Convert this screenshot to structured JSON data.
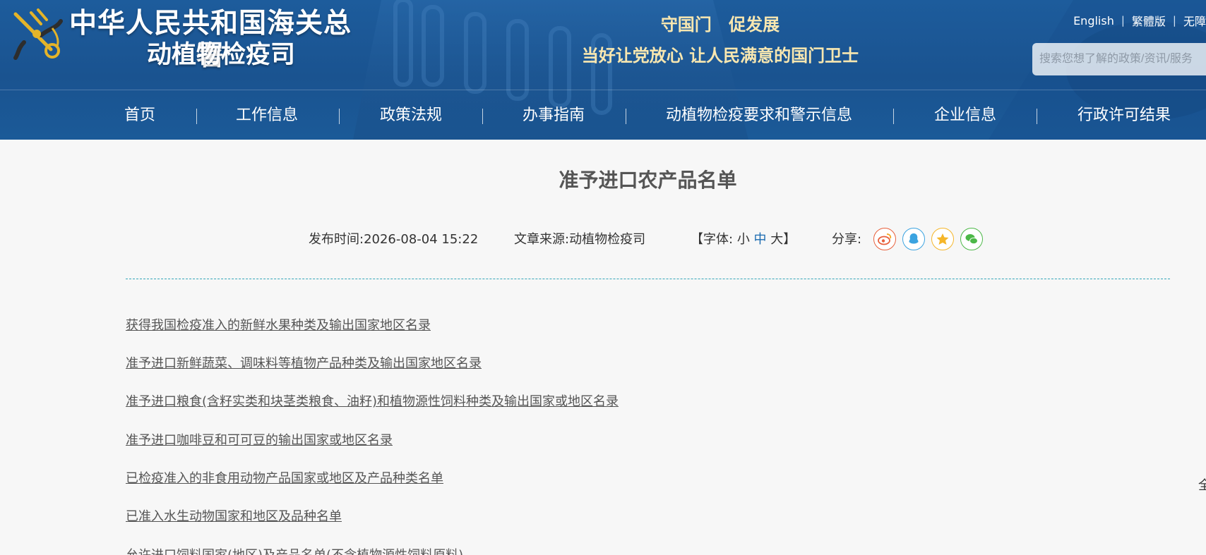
{
  "header": {
    "title_line1": "中华人民共和国海关总署",
    "title_line2": "动植物检疫司",
    "slogan_line1": "守国门  促发展",
    "slogan_line2": "当好让党放心   让人民满意的国门卫士",
    "lang_links": [
      "English",
      "繁體版",
      "无障"
    ],
    "search_placeholder": "搜索您想了解的政策/资讯/服务"
  },
  "nav": {
    "items": [
      "首页",
      "工作信息",
      "政策法规",
      "办事指南",
      "动植物检疫要求和警示信息",
      "企业信息",
      "行政许可结果"
    ]
  },
  "article": {
    "title": "准予进口农产品名单",
    "publish_label": "发布时间:",
    "publish_time": "2026-08-04 15:22",
    "source_label": "文章来源:",
    "source": "动植物检疫司",
    "font_prefix": "【字体:",
    "font_small": "小",
    "font_medium": "中",
    "font_large": "大",
    "font_suffix": "】",
    "share_label": "分享:",
    "share_icons": [
      "weibo-icon",
      "qq-icon",
      "qzone-icon",
      "wechat-icon"
    ],
    "links": [
      "获得我国检疫准入的新鲜水果种类及输出国家地区名录",
      "准予进口新鲜蔬菜、调味料等植物产品种类及输出国家地区名录",
      "准予进口粮食(含籽实类和块茎类粮食、油籽)和植物源性饲料种类及输出国家或地区名录",
      "准予进口咖啡豆和可可豆的输出国家或地区名录 ",
      "已检疫准入的非食用动物产品国家或地区及产品种类名单",
      "已准入水生动物国家和地区及品种名单",
      "允许进口饲料国家(地区)及产品名单(不含植物源性饲料原料)"
    ],
    "edge_glyph": "全"
  },
  "colors": {
    "header_blue": "#1b5a98",
    "slogan_gold": "#f8e7b0",
    "divider_teal": "#35a6b9",
    "weibo": "#e8603c",
    "qq": "#3ba3e0",
    "qzone": "#f5b62a",
    "wechat": "#4cb848"
  }
}
